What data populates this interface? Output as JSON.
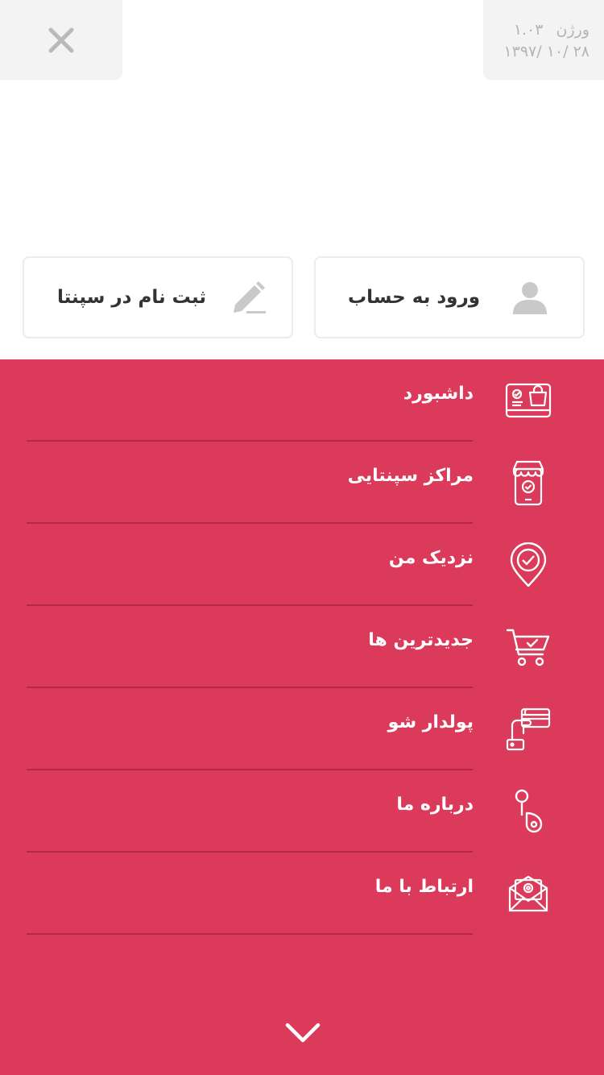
{
  "header": {
    "version_label": "ورژن",
    "version_number": "۱.۰۳",
    "version_date": "۲۸ /۱۰ /۱۳۹۷"
  },
  "account": {
    "login_label": "ورود به حساب",
    "signup_label": "ثبت نام در سپنتا"
  },
  "menu": {
    "items": [
      {
        "label": "داشبورد",
        "icon": "dashboard-icon"
      },
      {
        "label": "مراکز سپنتایی",
        "icon": "store-icon"
      },
      {
        "label": "نزدیک من",
        "icon": "location-pin-icon"
      },
      {
        "label": "جدیدترین ها",
        "icon": "cart-icon"
      },
      {
        "label": "پولدار شو",
        "icon": "card-hand-icon"
      },
      {
        "label": "درباره ما",
        "icon": "info-icon"
      },
      {
        "label": "ارتباط با ما",
        "icon": "mail-icon"
      }
    ]
  },
  "colors": {
    "menu_bg": "#db3a5a",
    "divider": "#b52843",
    "top_box_bg": "#f3f3f3"
  }
}
